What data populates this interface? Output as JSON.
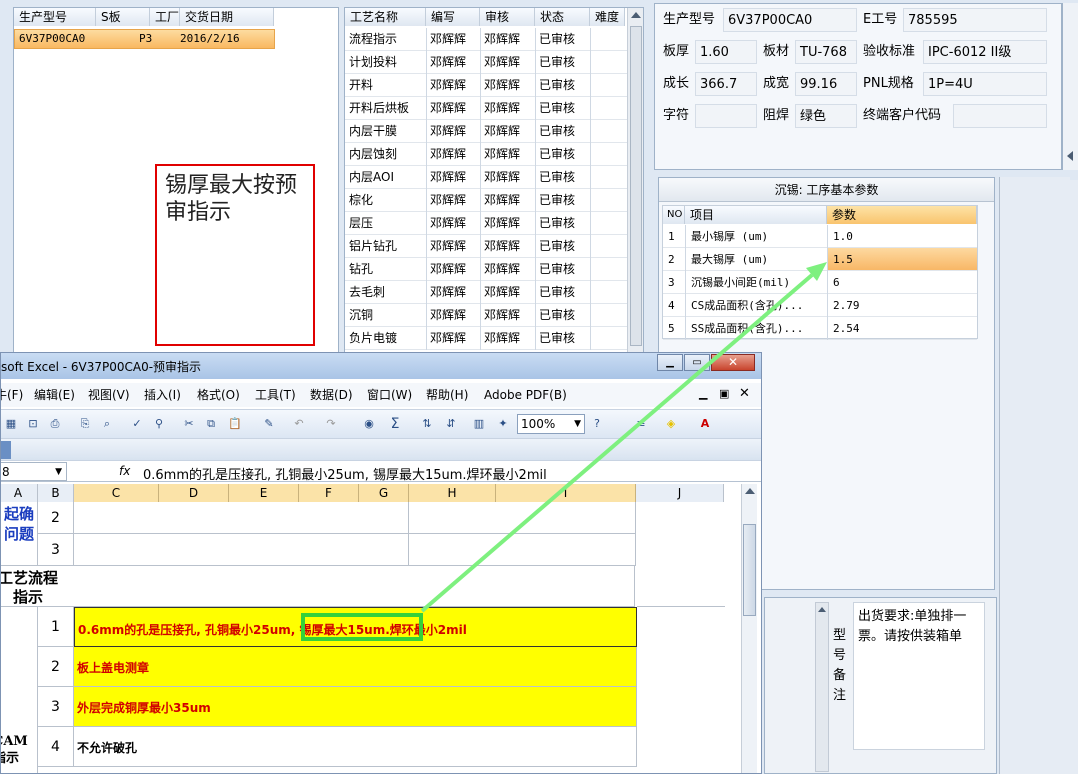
{
  "order_list": {
    "headers": [
      "生产型号",
      "S板",
      "工厂",
      "交货日期"
    ],
    "row": {
      "model": "6V37P00CA0",
      "factory": "P3",
      "date": "2016/2/16"
    }
  },
  "annotation": {
    "text": "锡厚最大按预审指示"
  },
  "process_list": {
    "headers": [
      "工艺名称",
      "编写",
      "审核",
      "状态",
      "难度"
    ],
    "rows": [
      {
        "name": "流程指示",
        "author": "邓辉辉",
        "reviewer": "邓辉辉",
        "status": "已审核"
      },
      {
        "name": "计划投料",
        "author": "邓辉辉",
        "reviewer": "邓辉辉",
        "status": "已审核"
      },
      {
        "name": "开料",
        "author": "邓辉辉",
        "reviewer": "邓辉辉",
        "status": "已审核"
      },
      {
        "name": "开料后烘板",
        "author": "邓辉辉",
        "reviewer": "邓辉辉",
        "status": "已审核"
      },
      {
        "name": "内层干膜",
        "author": "邓辉辉",
        "reviewer": "邓辉辉",
        "status": "已审核"
      },
      {
        "name": "内层蚀刻",
        "author": "邓辉辉",
        "reviewer": "邓辉辉",
        "status": "已审核"
      },
      {
        "name": "内层AOI",
        "author": "邓辉辉",
        "reviewer": "邓辉辉",
        "status": "已审核"
      },
      {
        "name": "棕化",
        "author": "邓辉辉",
        "reviewer": "邓辉辉",
        "status": "已审核"
      },
      {
        "name": "层压",
        "author": "邓辉辉",
        "reviewer": "邓辉辉",
        "status": "已审核"
      },
      {
        "name": "铝片钻孔",
        "author": "邓辉辉",
        "reviewer": "邓辉辉",
        "status": "已审核"
      },
      {
        "name": "钻孔",
        "author": "邓辉辉",
        "reviewer": "邓辉辉",
        "status": "已审核"
      },
      {
        "name": "去毛刺",
        "author": "邓辉辉",
        "reviewer": "邓辉辉",
        "status": "已审核"
      },
      {
        "name": "沉铜",
        "author": "邓辉辉",
        "reviewer": "邓辉辉",
        "status": "已审核"
      },
      {
        "name": "负片电镀",
        "author": "邓辉辉",
        "reviewer": "邓辉辉",
        "status": "已审核"
      }
    ]
  },
  "product_info": {
    "model_label": "生产型号",
    "model_value": "6V37P00CA0",
    "e_label": "E工号",
    "e_value": "785595",
    "thickness_label": "板厚",
    "thickness_value": "1.60",
    "material_label": "板材",
    "material_value": "TU-768",
    "standard_label": "验收标准",
    "standard_value": "IPC-6012 II级",
    "length_label": "成长",
    "length_value": "366.7",
    "width_label": "成宽",
    "width_value": "99.16",
    "pnl_label": "PNL规格",
    "pnl_value": "1P=4U",
    "char_label": "字符",
    "char_value": "",
    "mask_label": "阻焊",
    "mask_value": "绿色",
    "customer_label": "终端客户代码",
    "customer_value": ""
  },
  "params": {
    "title": "沉锡: 工序基本参数",
    "headers": [
      "NO",
      "项目",
      "参数"
    ],
    "rows": [
      {
        "no": "1",
        "item": "最小锡厚 (um)",
        "value": "1.0"
      },
      {
        "no": "2",
        "item": "最大锡厚 (um)",
        "value": "1.5"
      },
      {
        "no": "3",
        "item": "沉锡最小间距(mil)",
        "value": "6"
      },
      {
        "no": "4",
        "item": "CS成品面积(含孔)...",
        "value": "2.79"
      },
      {
        "no": "5",
        "item": "SS成品面积(含孔)...",
        "value": "2.54"
      }
    ]
  },
  "remarks": {
    "label": "型号备注",
    "text": "出货要求:单独排一票。请按供装箱单"
  },
  "excel": {
    "title": "soft Excel - 6V37P00CA0-预审指示",
    "menu": [
      "牛(F)",
      "编辑(E)",
      "视图(V)",
      "插入(I)",
      "格式(O)",
      "工具(T)",
      "数据(D)",
      "窗口(W)",
      "帮助(H)",
      "Adobe PDF(B)"
    ],
    "zoom": "100%",
    "name_box": "8",
    "fx": "fx",
    "formula": "0.6mm的孔是压接孔, 孔铜最小25um, 锡厚最大15um.焊环最小2mil",
    "columns": [
      "A",
      "B",
      "C",
      "D",
      "E",
      "F",
      "G",
      "H",
      "I",
      "J"
    ],
    "rows": {
      "r2": "2",
      "r3": "3",
      "confirm": "起确问题",
      "flow": "工艺流程指示",
      "cam": "CAM指示",
      "n1": "1",
      "n2": "2",
      "n3": "3",
      "n4": "4",
      "t1": "0.6mm的孔是压接孔, 孔铜最小25um, 锡厚最大15um.焊环最小2mil",
      "t2": "板上盖电测章",
      "t3": "外层完成铜厚最小35um",
      "t4": "不允许破孔"
    }
  }
}
